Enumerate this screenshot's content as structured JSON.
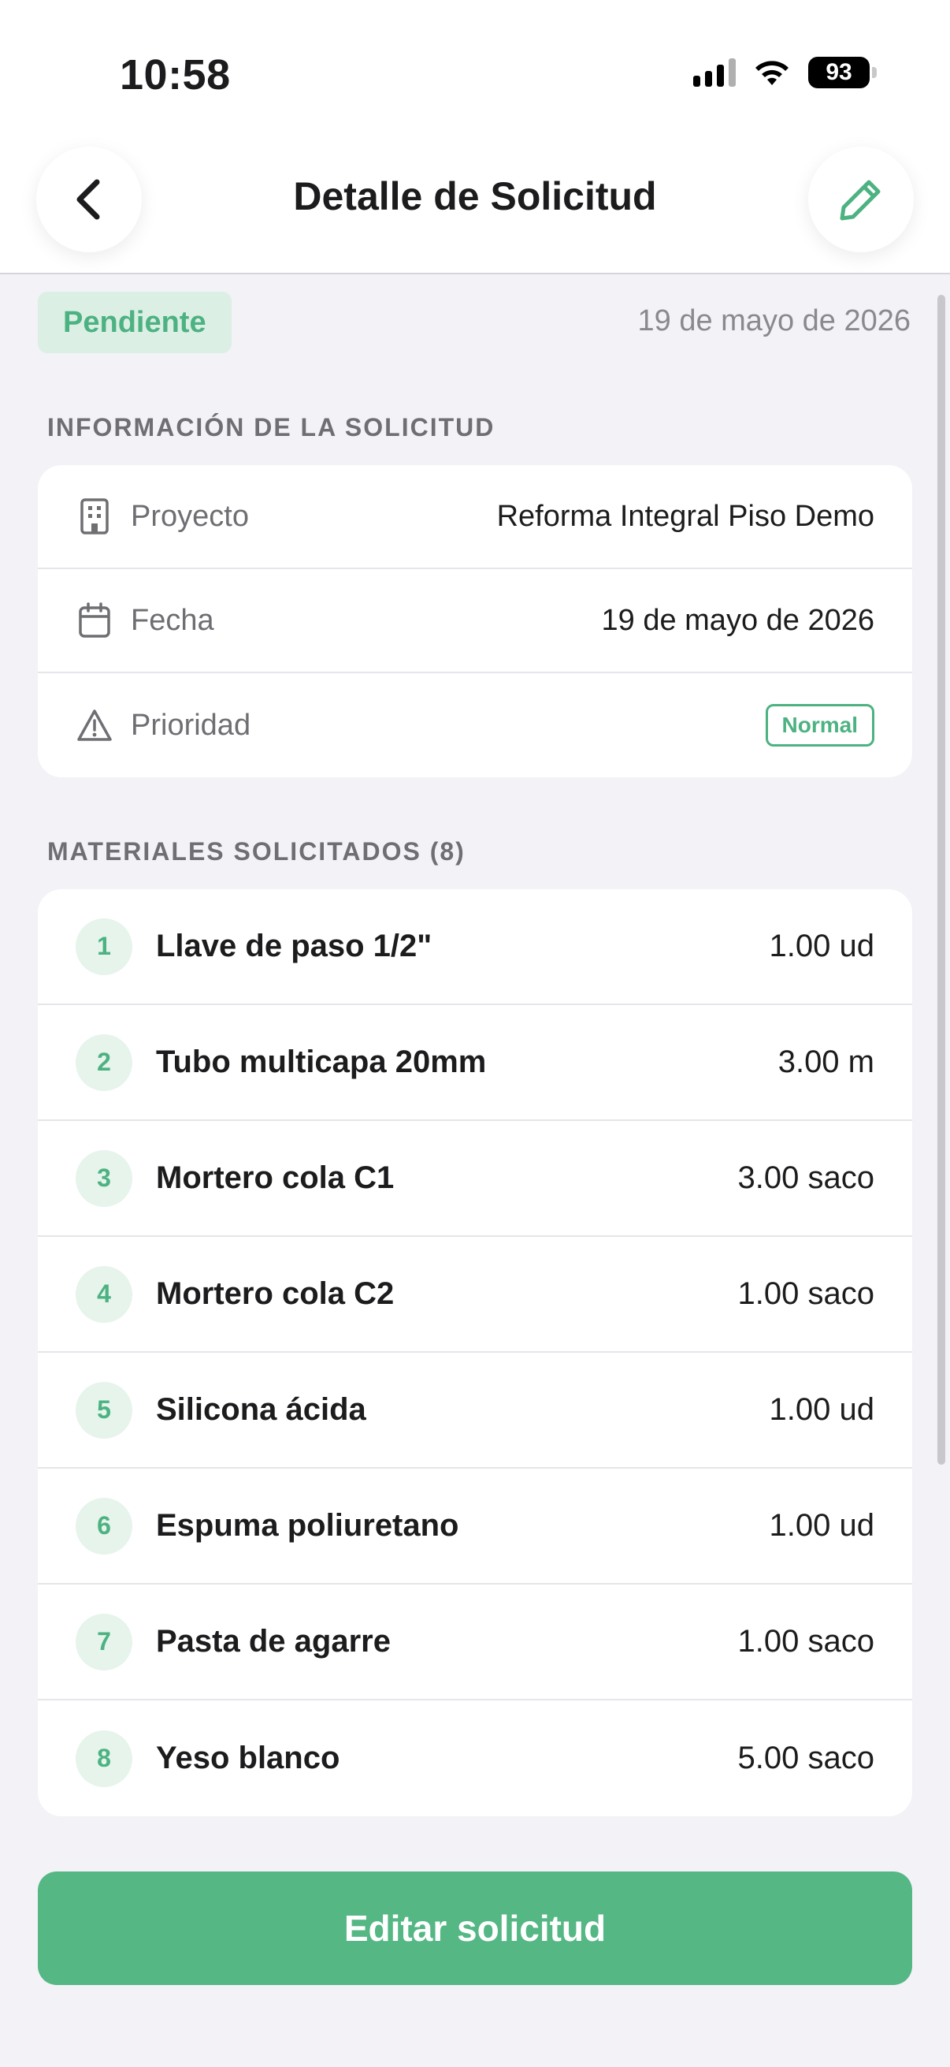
{
  "status_bar": {
    "time": "10:58",
    "battery": "93",
    "icons": [
      "signal-icon",
      "wifi-icon",
      "battery-icon"
    ]
  },
  "header": {
    "title": "Detalle de Solicitud",
    "back_icon": "chevron-left-icon",
    "edit_icon": "pencil-icon"
  },
  "request": {
    "status": "Pendiente",
    "date": "19 de mayo de 2026"
  },
  "info_section": {
    "title": "INFORMACIÓN DE LA SOLICITUD",
    "rows": [
      {
        "label": "Proyecto",
        "value": "Reforma Integral Piso Demo",
        "icon": "building-icon"
      },
      {
        "label": "Fecha",
        "value": "19 de mayo de 2026",
        "icon": "calendar-icon"
      },
      {
        "label": "Prioridad",
        "value": "Normal",
        "icon": "warning-icon"
      }
    ]
  },
  "materials_section": {
    "title": "MATERIALES SOLICITADOS (8)",
    "items": [
      {
        "num": "1",
        "name": "Llave de paso 1/2\"",
        "qty": "1.00 ud"
      },
      {
        "num": "2",
        "name": "Tubo multicapa 20mm",
        "qty": "3.00 m"
      },
      {
        "num": "3",
        "name": "Mortero cola C1",
        "qty": "3.00 saco"
      },
      {
        "num": "4",
        "name": "Mortero cola C2",
        "qty": "1.00 saco"
      },
      {
        "num": "5",
        "name": "Silicona ácida",
        "qty": "1.00 ud"
      },
      {
        "num": "6",
        "name": "Espuma poliuretano",
        "qty": "1.00 ud"
      },
      {
        "num": "7",
        "name": "Pasta de agarre",
        "qty": "1.00 saco"
      },
      {
        "num": "8",
        "name": "Yeso blanco",
        "qty": "5.00 saco"
      }
    ]
  },
  "actions": {
    "edit_label": "Editar solicitud"
  },
  "colors": {
    "accent": "#54b784",
    "accent_light": "#dcefe5",
    "background": "#f2f2f7"
  }
}
